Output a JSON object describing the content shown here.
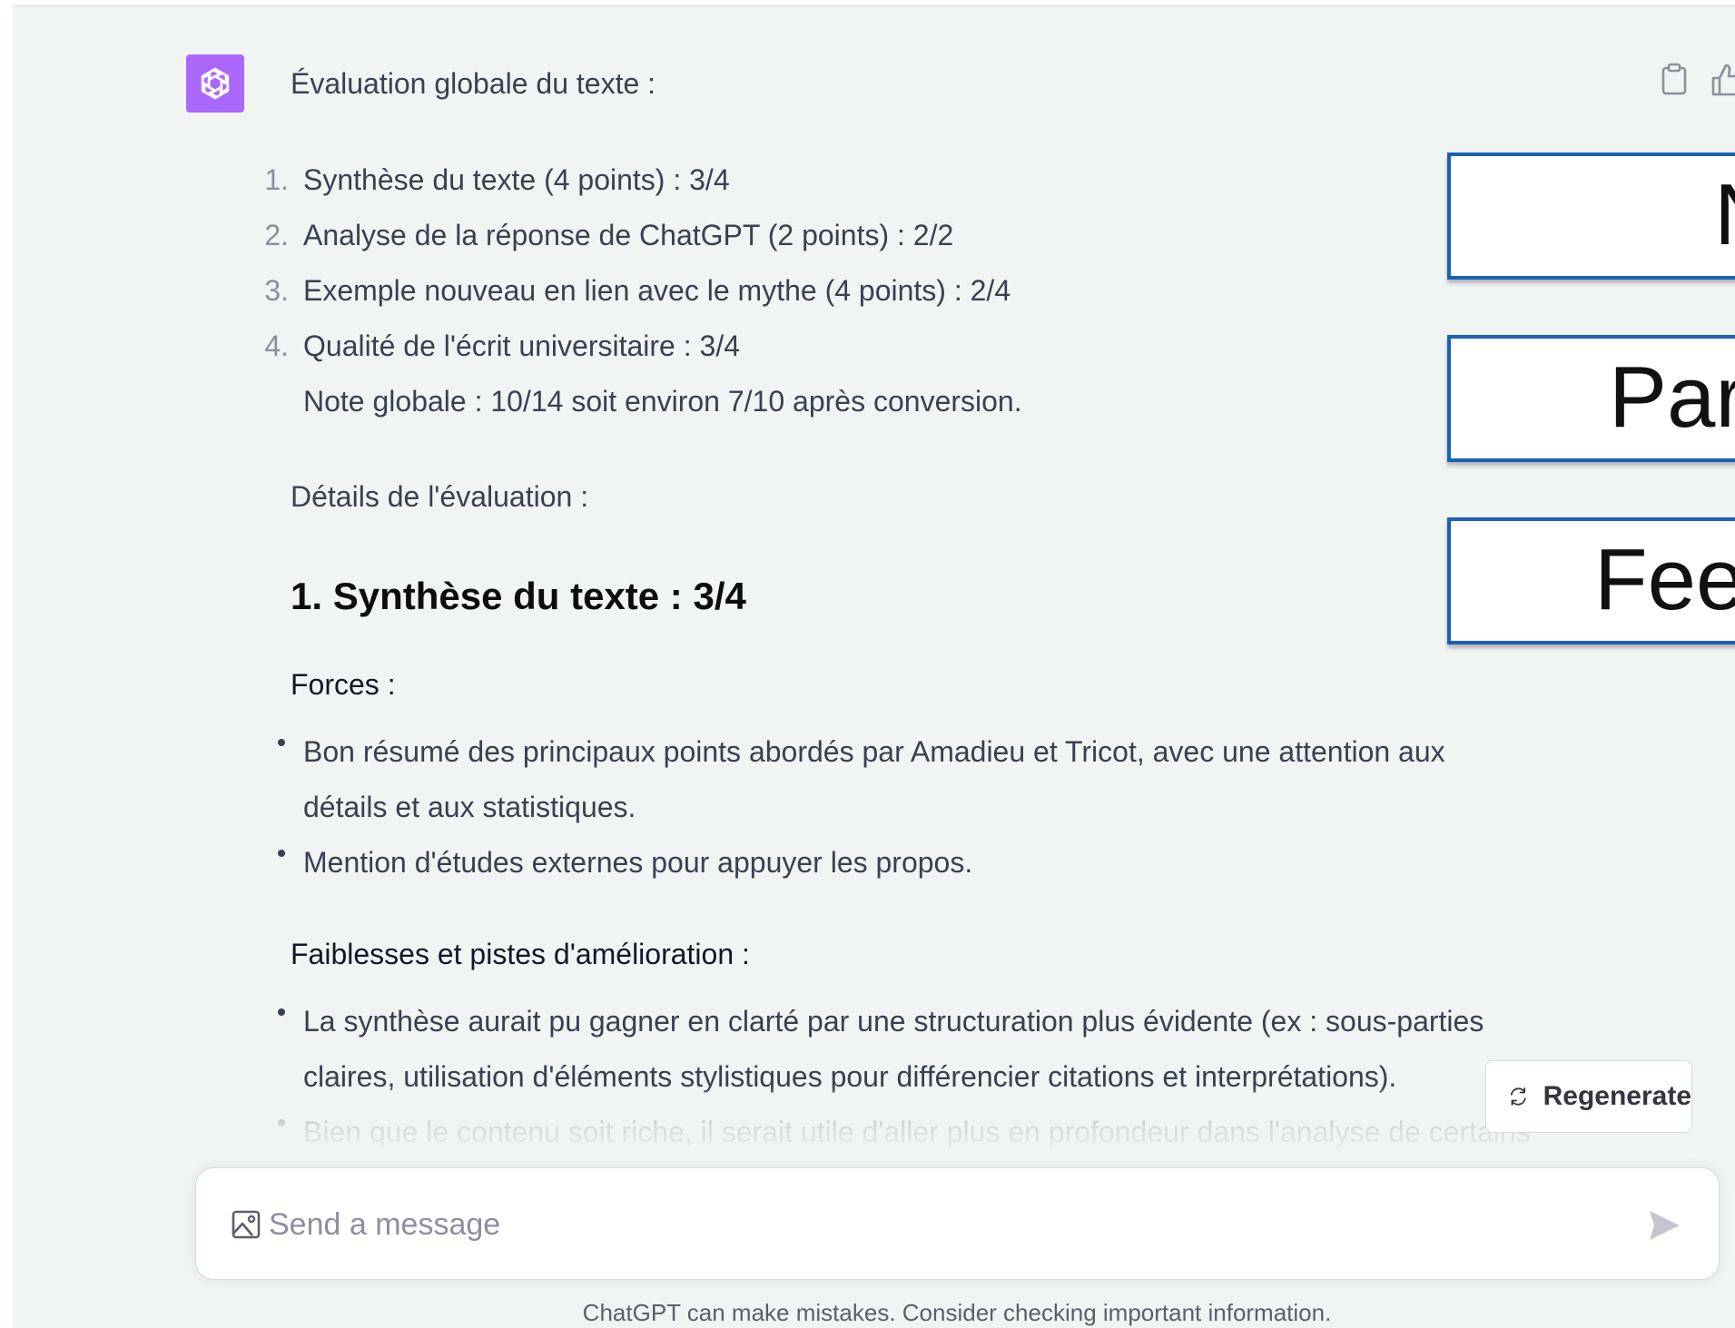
{
  "message": {
    "intro": "Évaluation globale du texte :",
    "scores": [
      {
        "num": "1.",
        "text": "Synthèse du texte (4 points) : 3/4"
      },
      {
        "num": "2.",
        "text": "Analyse de la réponse de ChatGPT (2 points) : 2/2"
      },
      {
        "num": "3.",
        "text": "Exemple nouveau en lien avec le mythe (4 points) : 2/4"
      },
      {
        "num": "4.",
        "text": "Qualité de l'écrit universitaire : 3/4"
      }
    ],
    "global_note": "Note globale : 10/14 soit environ 7/10 après conversion.",
    "details_label": "Détails de l'évaluation :",
    "section_heading": "1. Synthèse du texte : 3/4",
    "forces_label": "Forces :",
    "forces": [
      {
        "line1": "Bon résumé des principaux points abordés par Amadieu et Tricot, avec une attention aux",
        "line2": "détails et aux statistiques."
      },
      {
        "line1": "Mention d'études externes pour appuyer les propos."
      }
    ],
    "weak_label": "Faiblesses et pistes d'amélioration :",
    "weaknesses": [
      {
        "line1": "La synthèse aurait pu gagner en clarté par une structuration plus évidente (ex : sous-parties",
        "line2": "claires, utilisation d'éléments stylistiques pour différencier citations et interprétations)."
      },
      {
        "line1": "Bien que le contenu soit riche, il serait utile d'aller plus en profondeur dans l'analyse de certains"
      }
    ]
  },
  "actions": {
    "copy_icon": "clipboard-icon",
    "like_icon": "thumbs-up-icon"
  },
  "overlay_labels": [
    "N",
    "Par",
    "Fee"
  ],
  "regenerate": {
    "label": "Regenerate",
    "icon": "refresh-icon"
  },
  "composer": {
    "placeholder": "Send a message",
    "attach_icon": "image-icon",
    "send_icon": "send-icon"
  },
  "disclaimer": "ChatGPT can make mistakes. Consider checking important information.",
  "colors": {
    "avatar_bg": "#ab68ff",
    "panel_bg": "#f0f4f2",
    "overlay_border": "#1a60b8"
  }
}
